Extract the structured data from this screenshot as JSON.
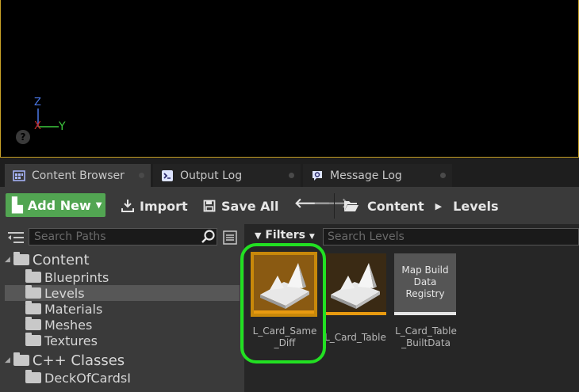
{
  "viewport": {
    "axis_z": "Z",
    "axis_x": "X",
    "axis_y": "Y",
    "help_glyph": "?"
  },
  "tabs": [
    {
      "label": "Content Browser",
      "icon": "content-browser-icon"
    },
    {
      "label": "Output Log",
      "icon": "output-log-icon"
    },
    {
      "label": "Message Log",
      "icon": "message-log-icon"
    }
  ],
  "toolbar": {
    "add_new": "Add New",
    "import": "Import",
    "save_all": "Save All",
    "path": [
      "Content",
      "Levels"
    ]
  },
  "sources": {
    "search_placeholder": "Search Paths",
    "tree": [
      {
        "label": "Content",
        "type": "root"
      },
      {
        "label": "Blueprints",
        "type": "folder"
      },
      {
        "label": "Levels",
        "type": "folder",
        "selected": true
      },
      {
        "label": "Materials",
        "type": "folder"
      },
      {
        "label": "Meshes",
        "type": "folder"
      },
      {
        "label": "Textures",
        "type": "folder"
      },
      {
        "label": "C++ Classes",
        "type": "root"
      },
      {
        "label": "DeckOfCardsI",
        "type": "class-folder"
      }
    ]
  },
  "assets": {
    "filters_label": "Filters",
    "search_placeholder": "Search Levels",
    "items": [
      {
        "name_line1": "L_Card_Same",
        "name_line2": "_Diff",
        "kind": "level",
        "selected": true
      },
      {
        "name_line1": "L_Card_Table",
        "name_line2": "",
        "kind": "level",
        "selected": false
      },
      {
        "name_line1": "L_Card_Table",
        "name_line2": "_BuiltData",
        "kind": "map-build-data",
        "thumb_text": "Map Build Data Registry",
        "selected": false
      }
    ]
  },
  "colors": {
    "accent_green": "#52a552",
    "selection_ring": "#22e022",
    "level_orange": "#c8880a",
    "viewport_border": "#c9a227"
  }
}
